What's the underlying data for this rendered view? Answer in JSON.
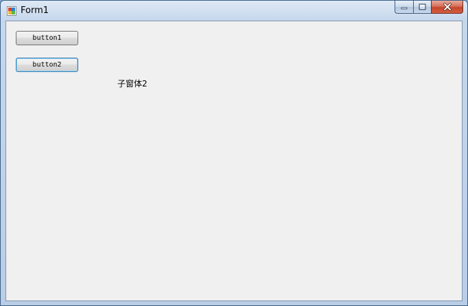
{
  "window": {
    "title": "Form1",
    "icon": "winforms-app-icon",
    "caption_buttons": [
      "minimize-icon",
      "maximize-icon",
      "close-icon"
    ]
  },
  "form": {
    "button1_label": "button1",
    "button2_label": "button2",
    "label_text": "子窗体2"
  },
  "colors": {
    "client_background": "#f0f0f0",
    "close_button": "#c4462b",
    "focus_border": "#3c7fb1"
  }
}
